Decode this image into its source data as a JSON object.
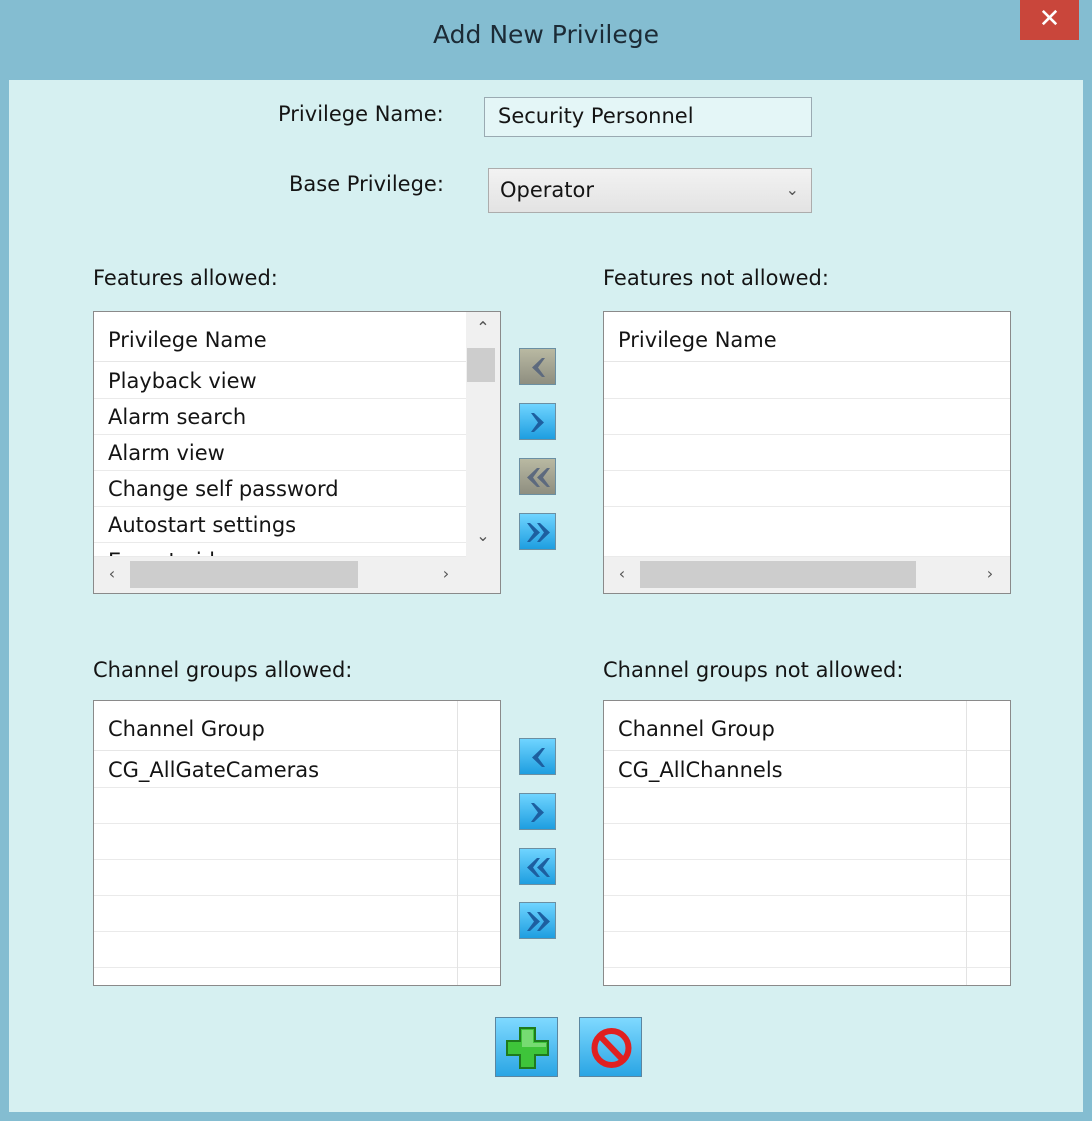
{
  "window": {
    "title": "Add New Privilege",
    "close_glyph": "✕"
  },
  "form": {
    "privilege_name_label": "Privilege Name:",
    "privilege_name_value": "Security Personnel",
    "base_privilege_label": "Base Privilege:",
    "base_privilege_value": "Operator"
  },
  "features_allowed": {
    "label": "Features allowed:",
    "header": "Privilege Name",
    "items": [
      "Playback view",
      "Alarm search",
      "Alarm view",
      "Change self password",
      "Autostart settings",
      "Export video"
    ]
  },
  "features_not_allowed": {
    "label": "Features not allowed:",
    "header": "Privilege Name",
    "items": []
  },
  "channel_groups_allowed": {
    "label": "Channel groups allowed:",
    "header": "Channel Group",
    "items": [
      "CG_AllGateCameras"
    ]
  },
  "channel_groups_not_allowed": {
    "label": "Channel groups not allowed:",
    "header": "Channel Group",
    "items": [
      "CG_AllChannels"
    ]
  },
  "icons": {
    "close": "close-icon",
    "move_left": "chevron-left-icon",
    "move_right": "chevron-right-icon",
    "move_all_left": "double-chevron-left-icon",
    "move_all_right": "double-chevron-right-icon",
    "add": "plus-icon",
    "cancel": "prohibited-icon",
    "scroll_up": "chevron-up-icon",
    "scroll_down": "chevron-down-icon",
    "scroll_left": "chevron-left-icon",
    "scroll_right": "chevron-right-icon"
  },
  "colors": {
    "background": "#d6f0f1",
    "frame": "#84bdd1",
    "close_button": "#c9463b",
    "button_active": "#1e9ee0",
    "button_disabled": "#8e8e80",
    "add_icon": "#3ec43a",
    "cancel_icon": "#e02020"
  }
}
